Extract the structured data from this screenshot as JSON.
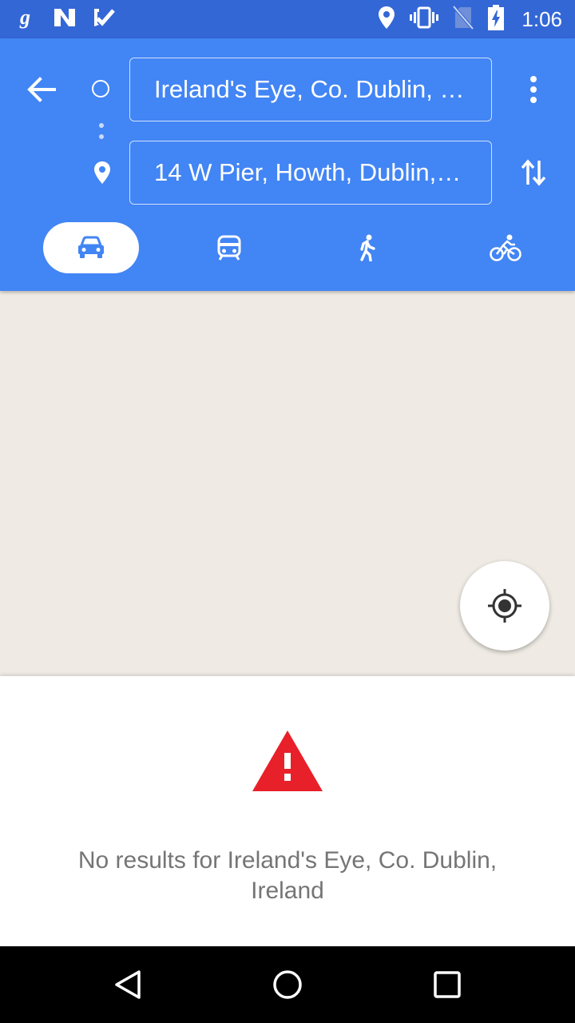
{
  "status_bar": {
    "time": "1:06",
    "notification_icons": [
      "gboard-g-icon",
      "n-app-icon",
      "tasks-check-icon"
    ],
    "system_icons": [
      "location-icon",
      "vibrate-icon",
      "no-sim-icon",
      "battery-charging-icon"
    ]
  },
  "directions": {
    "origin": {
      "value": "Ireland's Eye, Co. Dublin, Ireland"
    },
    "destination": {
      "value": "14 W Pier, Howth, Dublin, Ireland"
    },
    "modes": [
      {
        "name": "driving",
        "icon": "car-icon",
        "selected": true
      },
      {
        "name": "transit",
        "icon": "train-icon",
        "selected": false
      },
      {
        "name": "walking",
        "icon": "walking-icon",
        "selected": false
      },
      {
        "name": "cycling",
        "icon": "bicycle-icon",
        "selected": false
      }
    ]
  },
  "error": {
    "message": "No results for Ireland's Eye, Co. Dublin, Ireland"
  },
  "colors": {
    "status_bar": "#3367d6",
    "header": "#4285f4",
    "map_background": "#efebe4",
    "warning": "#e8202a",
    "message_text": "#757575"
  }
}
